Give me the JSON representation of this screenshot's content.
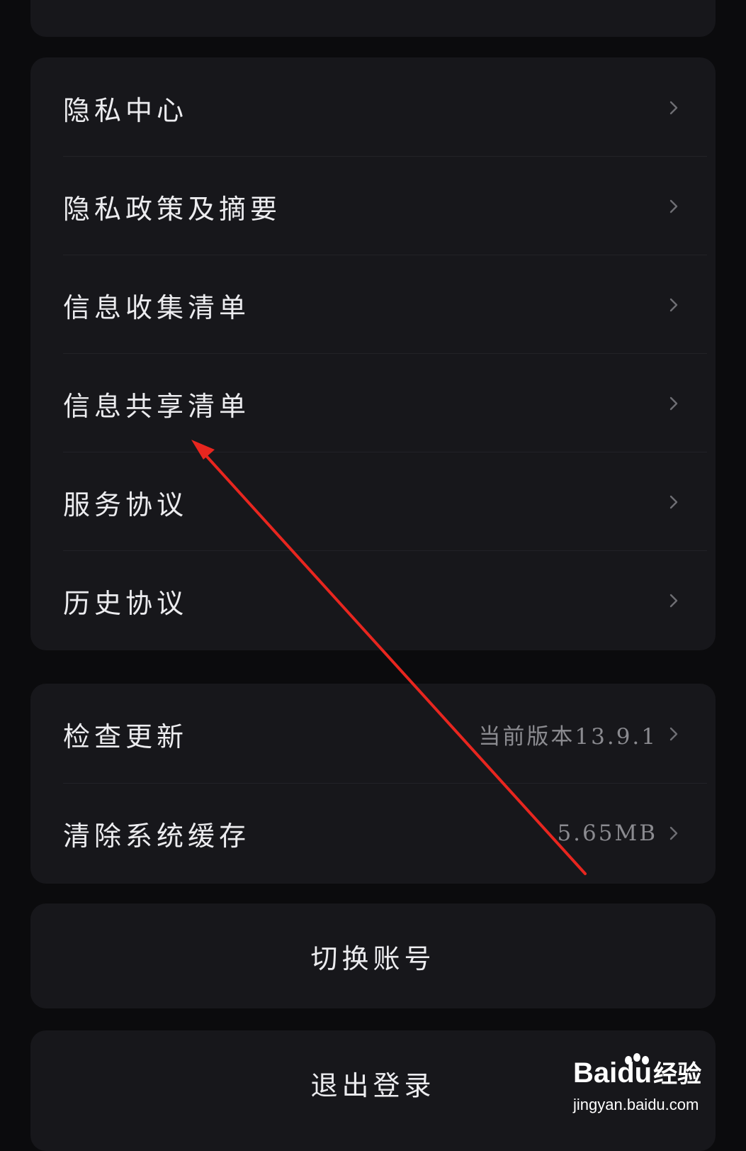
{
  "top_card": {},
  "privacy_card": {
    "items": [
      {
        "label": "隐私中心"
      },
      {
        "label": "隐私政策及摘要"
      },
      {
        "label": "信息收集清单"
      },
      {
        "label": "信息共享清单"
      },
      {
        "label": "服务协议"
      },
      {
        "label": "历史协议"
      }
    ]
  },
  "system_card": {
    "check_update": {
      "label": "检查更新",
      "value": "当前版本13.9.1"
    },
    "clear_cache": {
      "label": "清除系统缓存",
      "value": "5.65MB"
    }
  },
  "switch_account": {
    "label": "切换账号"
  },
  "logout": {
    "label": "退出登录"
  },
  "annotation": {
    "color": "#e8261f"
  },
  "watermark": {
    "brand": "Bai",
    "brand_suffix": "du",
    "brand_cn": "经验",
    "url": "jingyan.baidu.com"
  },
  "colors": {
    "background": "#0b0b0d",
    "card": "#17171b",
    "text": "#ececef",
    "secondary_text": "#8b8b90",
    "chevron": "#6e6e73"
  }
}
